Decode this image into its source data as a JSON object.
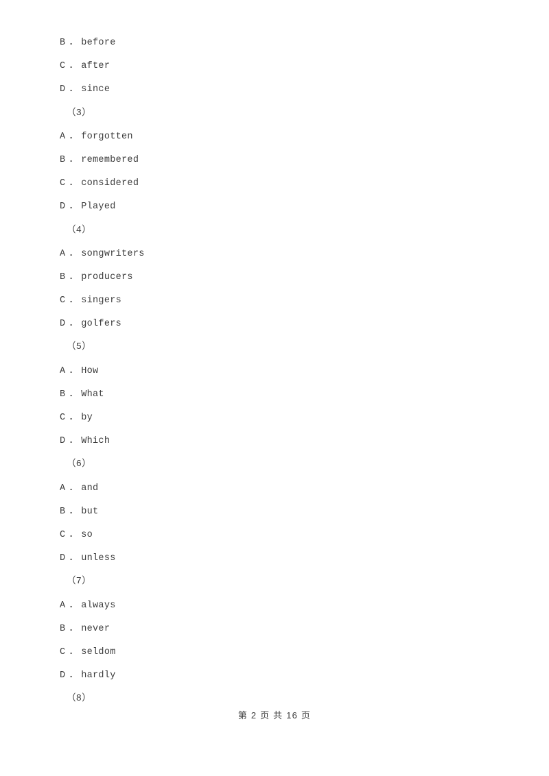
{
  "document": {
    "page_background": "#ffffff",
    "text_color": "#3b3b3b"
  },
  "body_lines": [
    {
      "kind": "option",
      "letter": "B",
      "separator": "．",
      "text": "before"
    },
    {
      "kind": "option",
      "letter": "C",
      "separator": "．",
      "text": "after"
    },
    {
      "kind": "option",
      "letter": "D",
      "separator": "．",
      "text": "since"
    },
    {
      "kind": "question",
      "label": "（3）"
    },
    {
      "kind": "option",
      "letter": "A",
      "separator": "．",
      "text": "forgotten"
    },
    {
      "kind": "option",
      "letter": "B",
      "separator": "．",
      "text": "remembered"
    },
    {
      "kind": "option",
      "letter": "C",
      "separator": "．",
      "text": "considered"
    },
    {
      "kind": "option",
      "letter": "D",
      "separator": "．",
      "text": "Played"
    },
    {
      "kind": "question",
      "label": "（4）"
    },
    {
      "kind": "option",
      "letter": "A",
      "separator": "．",
      "text": "songwriters"
    },
    {
      "kind": "option",
      "letter": "B",
      "separator": "．",
      "text": "producers"
    },
    {
      "kind": "option",
      "letter": "C",
      "separator": "．",
      "text": "singers"
    },
    {
      "kind": "option",
      "letter": "D",
      "separator": "．",
      "text": "golfers"
    },
    {
      "kind": "question",
      "label": "（5）"
    },
    {
      "kind": "option",
      "letter": "A",
      "separator": "．",
      "text": "How"
    },
    {
      "kind": "option",
      "letter": "B",
      "separator": "．",
      "text": "What"
    },
    {
      "kind": "option",
      "letter": "C",
      "separator": "．",
      "text": "by"
    },
    {
      "kind": "option",
      "letter": "D",
      "separator": "．",
      "text": "Which"
    },
    {
      "kind": "question",
      "label": "（6）"
    },
    {
      "kind": "option",
      "letter": "A",
      "separator": "．",
      "text": "and"
    },
    {
      "kind": "option",
      "letter": "B",
      "separator": "．",
      "text": "but"
    },
    {
      "kind": "option",
      "letter": "C",
      "separator": "．",
      "text": "so"
    },
    {
      "kind": "option",
      "letter": "D",
      "separator": "．",
      "text": "unless"
    },
    {
      "kind": "question",
      "label": "（7）"
    },
    {
      "kind": "option",
      "letter": "A",
      "separator": "．",
      "text": "always"
    },
    {
      "kind": "option",
      "letter": "B",
      "separator": "．",
      "text": "never"
    },
    {
      "kind": "option",
      "letter": "C",
      "separator": "．",
      "text": "seldom"
    },
    {
      "kind": "option",
      "letter": "D",
      "separator": "．",
      "text": "hardly"
    },
    {
      "kind": "question",
      "label": "（8）"
    }
  ],
  "footer": {
    "text": "第 2 页 共 16 页",
    "current_page": "2",
    "total_pages": "16"
  }
}
